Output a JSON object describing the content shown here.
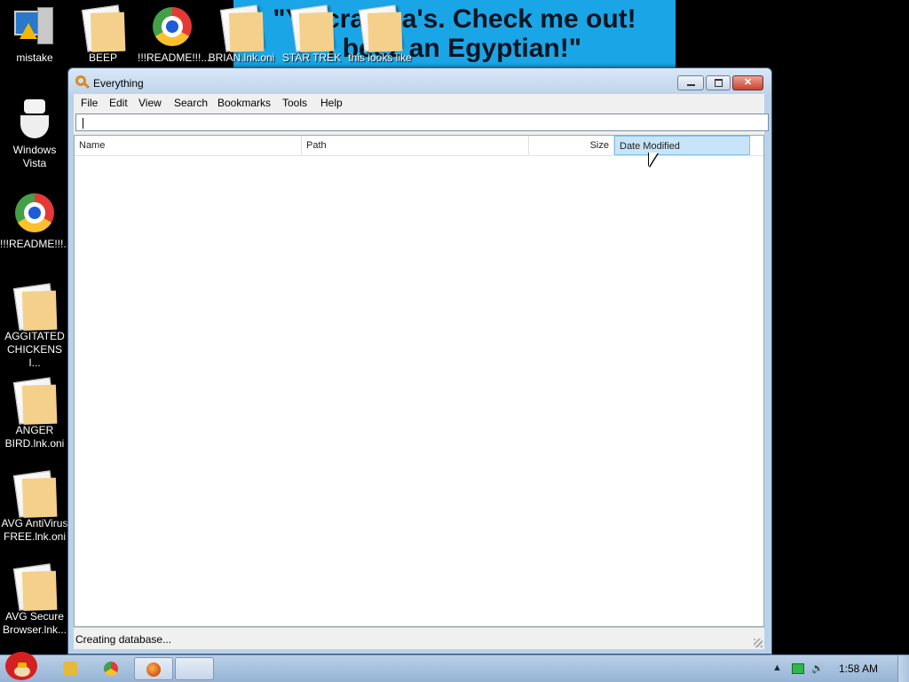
{
  "wallpaper": {
    "line1": "\"Yo crac ka's. Check me out!",
    "line2": "I beez an Egyptian!\""
  },
  "desktop_icons": [
    {
      "label": "mistake",
      "icon": "computer-warning-icon"
    },
    {
      "label": "Windows Vista",
      "icon": "toilet-icon"
    },
    {
      "label": "!!!README!!!...",
      "icon": "chrome-like-icon"
    },
    {
      "label": "AGGITATED CHICKENS I...",
      "icon": "document-icon"
    },
    {
      "label": "ANGER BIRD.lnk.oni",
      "icon": "document-icon"
    },
    {
      "label": "AVG AntiVirus FREE.lnk.oni",
      "icon": "document-icon"
    },
    {
      "label": "AVG Secure Browser.lnk...",
      "icon": "document-icon"
    },
    {
      "label": "BEEP",
      "icon": "document-icon"
    },
    {
      "label": "!!!README!!!...",
      "icon": "chrome-like-icon"
    },
    {
      "label": "BRIAN.lnk.oni",
      "icon": "document-icon"
    },
    {
      "label": "STAR TREK",
      "icon": "document-icon"
    },
    {
      "label": "this looks like",
      "icon": "document-icon"
    }
  ],
  "window": {
    "title": "Everything",
    "menu": [
      "File",
      "Edit",
      "View",
      "Search",
      "Bookmarks",
      "Tools",
      "Help"
    ],
    "search": {
      "value": "",
      "placeholder": ""
    },
    "columns": {
      "name": "Name",
      "path": "Path",
      "size": "Size",
      "date": "Date Modified"
    },
    "status": "Creating database..."
  },
  "taskbar": {
    "clock": "1:58 AM"
  }
}
